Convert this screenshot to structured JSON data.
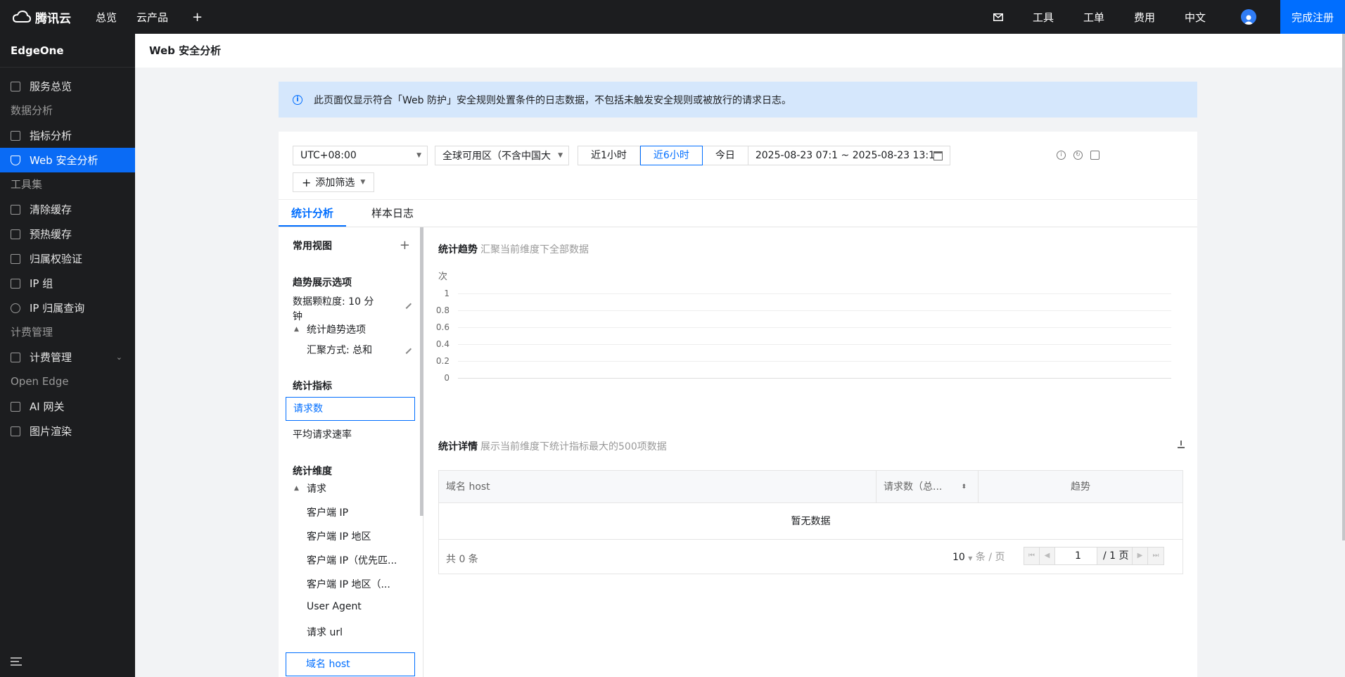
{
  "topbar": {
    "logo_text": "腾讯云",
    "nav": [
      "总览",
      "云产品"
    ],
    "add": "+",
    "right": [
      "工具",
      "工单",
      "费用",
      "中文"
    ],
    "register": "完成注册"
  },
  "sidebar": {
    "product": "EdgeOne",
    "items": [
      {
        "type": "item",
        "label": "服务总览",
        "icon": "grid-icon"
      },
      {
        "type": "group",
        "label": "数据分析"
      },
      {
        "type": "item",
        "label": "指标分析",
        "icon": "chart-icon"
      },
      {
        "type": "item",
        "label": "Web 安全分析",
        "icon": "shield-icon",
        "active": true
      },
      {
        "type": "group",
        "label": "工具集"
      },
      {
        "type": "item",
        "label": "清除缓存",
        "icon": "clear-icon"
      },
      {
        "type": "item",
        "label": "预热缓存",
        "icon": "prefetch-icon"
      },
      {
        "type": "item",
        "label": "归属权验证",
        "icon": "verify-icon"
      },
      {
        "type": "item",
        "label": "IP 组",
        "icon": "ip-icon"
      },
      {
        "type": "item",
        "label": "IP 归属查询",
        "icon": "search-icon"
      },
      {
        "type": "group",
        "label": "计费管理"
      },
      {
        "type": "item",
        "label": "计费管理",
        "icon": "billing-icon",
        "expandable": true
      },
      {
        "type": "group",
        "label": "Open Edge"
      },
      {
        "type": "item",
        "label": "AI 网关",
        "icon": "gateway-icon"
      },
      {
        "type": "item",
        "label": "图片渲染",
        "icon": "image-icon"
      }
    ]
  },
  "page": {
    "title": "Web 安全分析",
    "notice": "此页面仅显示符合「Web 防护」安全规则处置条件的日志数据，不包括未触发安全规则或被放行的请求日志。"
  },
  "filters": {
    "timezone": "UTC+08:00",
    "region": "全球可用区（不含中国大",
    "ranges": [
      "近1小时",
      "近6小时",
      "今日"
    ],
    "active_range": "近6小时",
    "date_range": "2025-08-23 07:1 ~ 2025-08-23 13:1",
    "add_filter": "添加筛选"
  },
  "tabs": [
    "统计分析",
    "样本日志"
  ],
  "left_panel": {
    "common_view": "常用视图",
    "trend_options": "趋势展示选项",
    "granularity_1": "数据颗粒度: 10 分",
    "granularity_2": "钟",
    "trend_sub": "统计趋势选项",
    "agg": "汇聚方式: 总和",
    "metrics_title": "统计指标",
    "metrics": [
      "请求数",
      "平均请求速率"
    ],
    "dims_title": "统计维度",
    "dims_group": "请求",
    "dims": [
      "客户端 IP",
      "客户端 IP 地区",
      "客户端 IP（优先匹...",
      "客户端 IP 地区（...",
      "User Agent",
      "请求 url",
      "域名 host"
    ]
  },
  "trend": {
    "title": "统计趋势",
    "subtitle": "汇聚当前维度下全部数据",
    "unit": "次"
  },
  "chart_data": {
    "type": "line",
    "title": "统计趋势",
    "ylabel": "次",
    "yticks": [
      "1",
      "0.8",
      "0.6",
      "0.4",
      "0.2",
      "0"
    ],
    "ylim": [
      0,
      1
    ],
    "series": []
  },
  "detail": {
    "title": "统计详情",
    "subtitle": "展示当前维度下统计指标最大的500项数据",
    "columns": [
      "域名 host",
      "请求数（总...",
      "趋势"
    ],
    "empty": "暂无数据",
    "total": "共 0 条",
    "page_size": "10",
    "page_size_unit": "条 / 页",
    "page": "1",
    "page_total": "/ 1 页"
  }
}
